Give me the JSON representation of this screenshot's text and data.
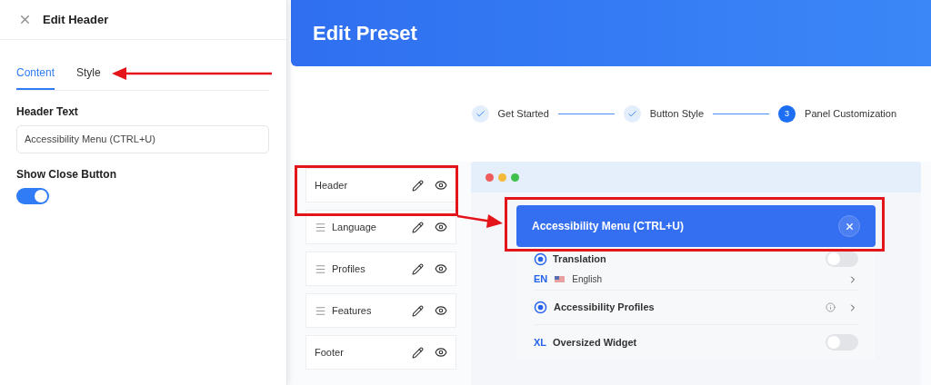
{
  "panel": {
    "title": "Edit Header",
    "tabs": [
      {
        "label": "Content",
        "selected": true
      },
      {
        "label": "Style",
        "selected": false
      }
    ],
    "field": {
      "label": "Header Text",
      "value": "Accessibility Menu (CTRL+U)"
    },
    "toggle": {
      "label": "Show Close Button",
      "on": true
    }
  },
  "banner": {
    "title": "Edit Preset"
  },
  "steps": [
    {
      "label": "Get Started",
      "done": true
    },
    {
      "label": "Button Style",
      "done": true
    },
    {
      "label": "Panel Customization",
      "done": false,
      "number": "3"
    }
  ],
  "sections": [
    {
      "label": "Header",
      "draggable": false
    },
    {
      "label": "Language",
      "draggable": true
    },
    {
      "label": "Profiles",
      "draggable": true
    },
    {
      "label": "Features",
      "draggable": true
    },
    {
      "label": "Footer",
      "draggable": false
    }
  ],
  "preview": {
    "header": {
      "title": "Accessibility Menu (CTRL+U)"
    },
    "translation": {
      "label": "Translation",
      "on": false,
      "code": "EN",
      "language": "English"
    },
    "items": [
      {
        "kind": "link",
        "label": "Accessibility Profiles"
      },
      {
        "kind": "toggle",
        "badge": "XL",
        "label": "Oversized Widget",
        "on": false
      }
    ]
  }
}
